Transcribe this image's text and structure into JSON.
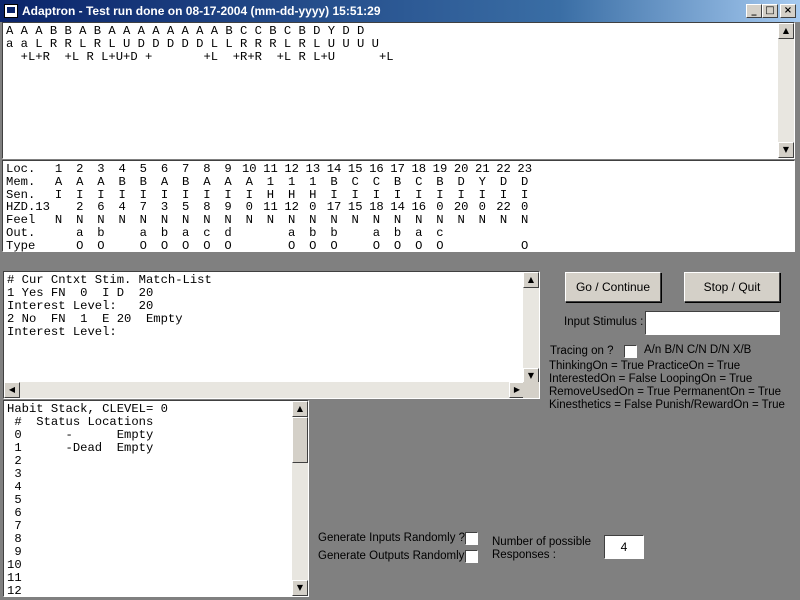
{
  "window": {
    "title": "Adaptron  -  Test run done on 08-17-2004 (mm-dd-yyyy) 15:51:29",
    "controls": {
      "minimize": "_",
      "maximize": "□",
      "close": "×"
    }
  },
  "top_area": {
    "lines": [
      "A A A B B A B A A A A A A A A B C C B C B D Y D D",
      "a a L R R L R L U D D D D D L L R R R L R L U U U U",
      "  +L+R  +L R L+U+D +       +L  +R+R  +L R L+U      +L"
    ]
  },
  "memory_table": {
    "rows": [
      {
        "label": "Loc.",
        "cells": [
          "1",
          "2",
          "3",
          "4",
          "5",
          "6",
          "7",
          "8",
          "9",
          "10",
          "11",
          "12",
          "13",
          "14",
          "15",
          "16",
          "17",
          "18",
          "19",
          "20",
          "21",
          "22",
          "23"
        ]
      },
      {
        "label": "Mem.",
        "cells": [
          "A",
          "A",
          "A",
          "B",
          "B",
          "A",
          "B",
          "A",
          "A",
          "A",
          "1",
          "1",
          "1",
          "B",
          "C",
          "C",
          "B",
          "C",
          "B",
          "D",
          "Y",
          "D",
          "D"
        ]
      },
      {
        "label": "Sen.",
        "cells": [
          "I",
          "I",
          "I",
          "I",
          "I",
          "I",
          "I",
          "I",
          "I",
          "I",
          "H",
          "H",
          "H",
          "I",
          "I",
          "I",
          "I",
          "I",
          "I",
          "I",
          "I",
          "I",
          "I"
        ]
      },
      {
        "label": "HZD.13",
        "cells": [
          "",
          "2",
          "6",
          "4",
          "7",
          "3",
          "5",
          "8",
          "9",
          "0",
          "11",
          "12",
          "0",
          "17",
          "15",
          "18",
          "14",
          "16",
          "0",
          "20",
          "0",
          "22",
          "0"
        ]
      },
      {
        "label": "Feel",
        "cells": [
          "N",
          "N",
          "N",
          "N",
          "N",
          "N",
          "N",
          "N",
          "N",
          "N",
          "N",
          "N",
          "N",
          "N",
          "N",
          "N",
          "N",
          "N",
          "N",
          "N",
          "N",
          "N",
          "N"
        ]
      },
      {
        "label": "Out.",
        "cells": [
          "",
          "a",
          "b",
          "",
          "a",
          "b",
          "a",
          "c",
          "d",
          "",
          "",
          "a",
          "b",
          "b",
          "",
          "a",
          "b",
          "a",
          "c",
          "",
          "",
          "",
          ""
        ]
      },
      {
        "label": "Type",
        "cells": [
          "",
          "O",
          "O",
          "",
          "O",
          "O",
          "O",
          "O",
          "O",
          "",
          "",
          "O",
          "O",
          "O",
          "",
          "O",
          "O",
          "O",
          "O",
          "",
          "",
          "",
          "O"
        ]
      }
    ]
  },
  "context_panel": {
    "lines": [
      "# Cur Cntxt Stim. Match-List",
      "1 Yes FN  0  I D  20",
      "Interest Level:   20",
      "2 No  FN  1  E 20  Empty",
      "Interest Level:"
    ]
  },
  "habit_stack": {
    "lines": [
      "Habit Stack, CLEVEL= 0",
      " #  Status Locations",
      " 0      -      Empty",
      " 1      -Dead  Empty",
      " 2",
      " 3",
      " 4",
      " 5",
      " 6",
      " 7",
      " 8",
      " 9",
      "10",
      "11",
      "12"
    ]
  },
  "controls": {
    "go_label": "Go / Continue",
    "stop_label": "Stop / Quit",
    "input_stimulus_label": "Input Stimulus :",
    "input_stimulus_value": "",
    "tracing_label": "Tracing on ?",
    "tracing_options": "A/n  B/N  C/N  D/N  X/B",
    "status_lines": [
      "ThinkingOn = True PracticeOn = True",
      "InterestedOn = False LoopingOn = True",
      "RemoveUsedOn = True PermanentOn = True",
      "Kinesthetics = False Punish/RewardOn = True"
    ],
    "gen_inputs_label": "Generate Inputs Randomly ?",
    "gen_outputs_label": "Generate Outputs Randomly?",
    "responses_label_1": "Number of possible",
    "responses_label_2": "Responses :",
    "responses_value": "4"
  }
}
